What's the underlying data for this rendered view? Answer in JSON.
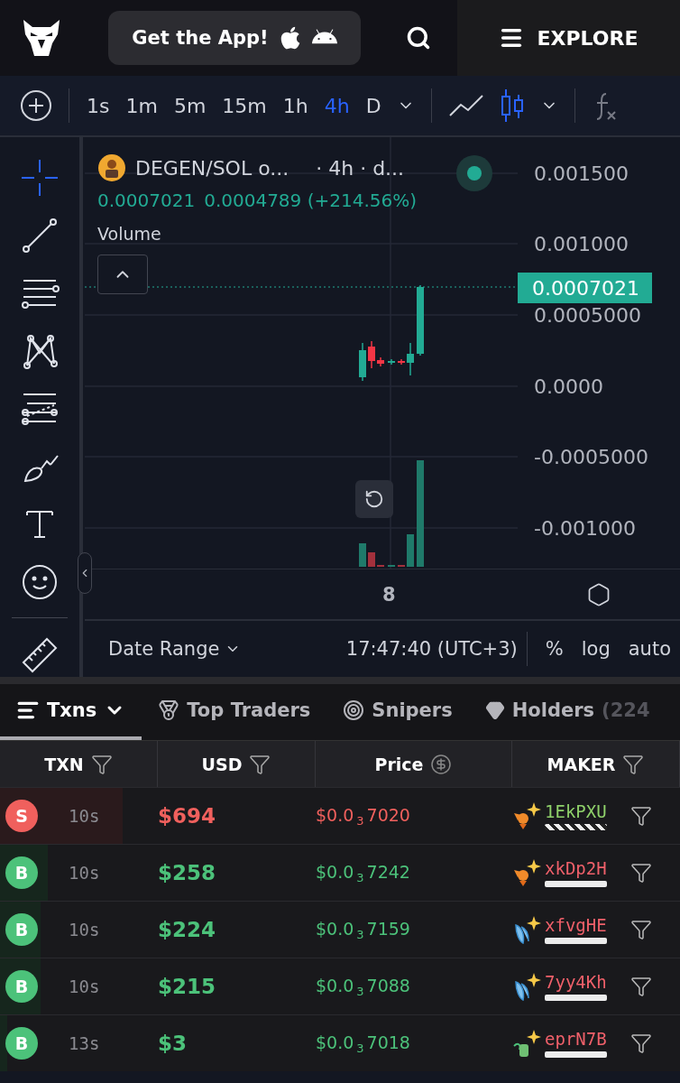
{
  "header": {
    "app_button": "Get the App!",
    "explore": "EXPLORE"
  },
  "toolbar": {
    "timeframes": [
      {
        "label": "1s",
        "selected": false
      },
      {
        "label": "1m",
        "selected": false
      },
      {
        "label": "5m",
        "selected": false
      },
      {
        "label": "15m",
        "selected": false
      },
      {
        "label": "1h",
        "selected": false
      },
      {
        "label": "4h",
        "selected": true
      },
      {
        "label": "D",
        "selected": false
      }
    ],
    "chart_types": [
      {
        "kind": "line",
        "selected": false
      },
      {
        "kind": "candles",
        "selected": true
      }
    ]
  },
  "tools": [
    {
      "kind": "crosshair",
      "selected": true
    },
    {
      "kind": "trendline",
      "selected": false
    },
    {
      "kind": "lines",
      "selected": false
    },
    {
      "kind": "pattern",
      "selected": false
    },
    {
      "kind": "fib",
      "selected": false
    },
    {
      "kind": "brush",
      "selected": false
    },
    {
      "kind": "text",
      "selected": false
    },
    {
      "kind": "emoji",
      "selected": false
    },
    {
      "kind": "ruler",
      "selected": false
    }
  ],
  "chart": {
    "symbol": "DEGEN/SOL o...",
    "interval": "· 4h · d...",
    "live": true,
    "last": "0.0007021",
    "change": "0.0004789 (+214.56%)",
    "volume_label": "Volume",
    "price_axis": [
      "0.001500",
      "0.001000",
      "0.0005000",
      "0.0000",
      "-0.0005000",
      "-0.001000"
    ],
    "current_price": "0.0007021",
    "time_tick": "8",
    "date_range": "Date Range",
    "clock": "17:47:40 (UTC+3)",
    "percent": "%",
    "log": "log",
    "auto": "auto"
  },
  "tabs": [
    {
      "kind": "list",
      "label": "Txns",
      "selected": true
    },
    {
      "kind": "medal",
      "label": "Top Traders",
      "selected": false
    },
    {
      "kind": "target",
      "label": "Snipers",
      "selected": false
    },
    {
      "kind": "diamond",
      "label": "Holders",
      "count": "(224",
      "selected": false
    }
  ],
  "table": {
    "columns": [
      {
        "label": "TXN",
        "kind": "filter"
      },
      {
        "label": "USD",
        "kind": "filter"
      },
      {
        "label": "Price",
        "kind": "dollar"
      },
      {
        "label": "MAKER",
        "kind": "filter"
      }
    ],
    "rows": [
      {
        "kind": "sell",
        "side": "S",
        "age": "10s",
        "usd": "$694",
        "price": "$0.0$_{3}$7020",
        "level": 0.18,
        "maker": {
          "address": "1EkPXU",
          "color": "#8fd16a",
          "kind": "fox",
          "striped": true
        }
      },
      {
        "kind": "buy",
        "side": "B",
        "age": "10s",
        "usd": "$258",
        "price": "$0.0$_{3}$7242",
        "level": 0.07,
        "maker": {
          "address": "xkDp2H",
          "color": "#f0606a",
          "kind": "fox",
          "striped": false
        }
      },
      {
        "kind": "buy",
        "side": "B",
        "age": "10s",
        "usd": "$224",
        "price": "$0.0$_{3}$7159",
        "level": 0.06,
        "maker": {
          "address": "xfvgHE",
          "color": "#f0606a",
          "kind": "wave",
          "striped": false
        }
      },
      {
        "kind": "buy",
        "side": "B",
        "age": "10s",
        "usd": "$215",
        "price": "$0.0$_{3}$7088",
        "level": 0.06,
        "maker": {
          "address": "7yy4Kh",
          "color": "#f0606a",
          "kind": "wave",
          "striped": false
        }
      },
      {
        "kind": "buy",
        "side": "B",
        "age": "13s",
        "usd": "$3",
        "price": "$0.0$_{3}$7018",
        "level": 0.01,
        "maker": {
          "address": "eprN7B",
          "color": "#f0606a",
          "kind": "sprout",
          "striped": false
        }
      }
    ]
  }
}
